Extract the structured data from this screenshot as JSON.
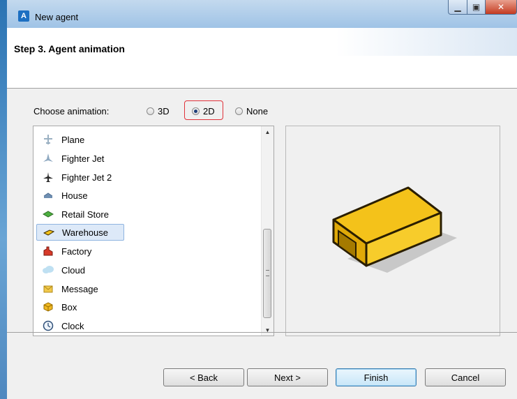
{
  "window": {
    "title": "New agent",
    "logo_text": "A",
    "minimize_glyph": "▁",
    "maximize_glyph": "▣",
    "close_glyph": "✕"
  },
  "header": {
    "step_title": "Step 3. Agent animation"
  },
  "animation": {
    "label": "Choose animation:",
    "options": [
      {
        "label": "3D",
        "selected": false
      },
      {
        "label": "2D",
        "selected": true
      },
      {
        "label": "None",
        "selected": false
      }
    ]
  },
  "list": {
    "items": [
      {
        "label": "Plane",
        "icon": "plane-icon"
      },
      {
        "label": "Fighter Jet",
        "icon": "fighter-jet-icon"
      },
      {
        "label": "Fighter Jet 2",
        "icon": "fighter-jet-2-icon"
      },
      {
        "label": "House",
        "icon": "house-icon"
      },
      {
        "label": "Retail Store",
        "icon": "retail-store-icon"
      },
      {
        "label": "Warehouse",
        "icon": "warehouse-icon",
        "selected": true
      },
      {
        "label": "Factory",
        "icon": "factory-icon"
      },
      {
        "label": "Cloud",
        "icon": "cloud-icon"
      },
      {
        "label": "Message",
        "icon": "message-icon"
      },
      {
        "label": "Box",
        "icon": "box-icon"
      },
      {
        "label": "Clock",
        "icon": "clock-icon"
      }
    ]
  },
  "buttons": {
    "back": "< Back",
    "next": "Next >",
    "finish": "Finish",
    "cancel": "Cancel"
  },
  "colors": {
    "highlight_border": "#e0323a",
    "warehouse_yellow": "#f4c21a",
    "selection_bg": "#dde9f8"
  }
}
